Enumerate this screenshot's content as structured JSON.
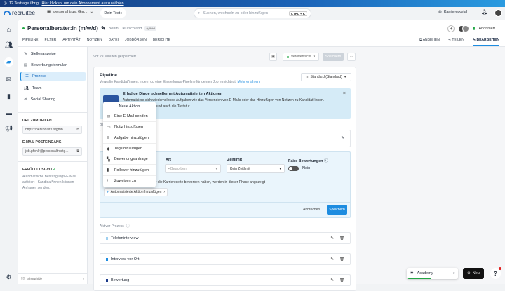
{
  "banner": {
    "text": "12 Testtage übrig.",
    "link": "Hier klicken, um dein Abonnement auszuwählen"
  },
  "topbar": {
    "logo": "recruitee",
    "company": "personal trust Gm...",
    "test_pill": "Dein Test",
    "search_placeholder": "Suchen, wechseln zu oder hinzufügen",
    "shortcut": "CTRL + K",
    "career_portal": "Karriereportal"
  },
  "job": {
    "title": "Personalberater:in (m/w/d)",
    "location": "Berlin, Deutschland",
    "tag": "#yflbh9",
    "subscribed": "Abonniert"
  },
  "tabs": [
    "PIPELINE",
    "FILTER",
    "AKTIVITÄT",
    "NOTIZEN",
    "DATEI",
    "JOBBÖRSEN",
    "BERICHTE"
  ],
  "right_tabs": [
    "ANSEHEN",
    "TEILEN",
    "BEARBEITEN"
  ],
  "sidebar": {
    "items": [
      {
        "label": "Stellenanzeige"
      },
      {
        "label": "Bewerbungsformular"
      },
      {
        "label": "Prozess"
      },
      {
        "label": "Team"
      },
      {
        "label": "Social Sharing"
      }
    ],
    "share_label": "URL ZUM TEILEN",
    "share_value": "https://personaltrustgmb...",
    "email_label": "E-MAIL POSTEINGANG",
    "email_value": "job.pfbh9@personaltrustg...",
    "gdpr_label": "ERFÜLLT DSGVO",
    "gdpr_text": "Automatische Bestätigungs-E-Mail aktiviert - Kandidat*innen können Anfragen senden.",
    "showhide": "Show/hide"
  },
  "toolbar": {
    "saved": "Vor 29 Minuten gespeichert",
    "status": "Veröffentlicht",
    "save": "Speichern"
  },
  "pipeline": {
    "title": "Pipeline",
    "subtitle": "Verwalte Kandidat*innen, indem du eine Einstellungs-Pipeline für deinen Job einrichtest.",
    "more": "Mehr erfahren",
    "select": "Standard (Standard)",
    "info_title": "Erledige Dinge schneller mit Automatisierten Aktionen",
    "info_line1": "Automatisiere sich wiederholende Aufgaben wie das Versenden von E-Mails oder das Hinzufügen von Notizen zu Kandidat*innen.",
    "info_line2": "Nutze deine Finger – und auch die Tastatur.",
    "section_label": "Be",
    "art_label": "Art",
    "art_value": "Beworben",
    "zeit_label": "Zeitlimit",
    "zeit_value": "Kein Zeitlimit",
    "fair_label": "Faire Bewertungen",
    "fair_value": "Nein",
    "hint": "er die Karriereseite beworben haben, werden in dieser Phase angezeigt",
    "auto_btn": "Automatisierte Aktion hinzufügen",
    "cancel": "Abbrechen",
    "save": "Speichern",
    "active_label": "Aktiver Prozess",
    "stages": [
      {
        "name": "Telefoninterview",
        "color": "#9fd0f0"
      },
      {
        "name": "Interview vor Ort",
        "color": "#1d8ce0"
      },
      {
        "name": "Bewertung",
        "color": "#1b3a8a"
      }
    ]
  },
  "menu": {
    "title": "Neue Aktion",
    "items": [
      "Eine E-Mail senden",
      "Notiz hinzufügen",
      "Aufgabe hinzufügen",
      "Tags hinzufügen",
      "Bewertungsanfrage",
      "Follower hinzufügen",
      "Zuweisen zu"
    ]
  },
  "widgets": {
    "academy": "Academy",
    "new": "Neu",
    "help": "?"
  }
}
